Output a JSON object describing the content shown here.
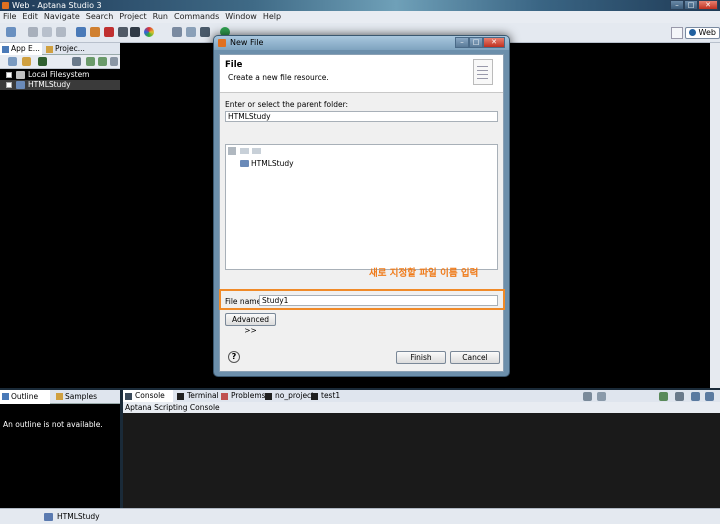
{
  "window": {
    "title": "Web - Aptana Studio 3"
  },
  "menu": [
    "File",
    "Edit",
    "Navigate",
    "Search",
    "Project",
    "Run",
    "Commands",
    "Window",
    "Help"
  ],
  "perspective": {
    "label": "Web"
  },
  "left_panel": {
    "tabs": [
      "App E...",
      "Projec..."
    ],
    "tree": [
      {
        "label": "Local Filesystem"
      },
      {
        "label": "HTMLStudy"
      }
    ]
  },
  "outline": {
    "tabs": [
      "Outline",
      "Samples"
    ],
    "message": "An outline is not available."
  },
  "console": {
    "tabs": [
      "Console",
      "Terminal",
      "Problems",
      "no_project",
      "test1"
    ],
    "header": "Aptana Scripting Console"
  },
  "statusbar": {
    "text": "HTMLStudy"
  },
  "dialog": {
    "title": "New File",
    "heading": "File",
    "description": "Create a new file resource.",
    "parent_label": "Enter or select the parent folder:",
    "parent_value": "HTMLStudy",
    "tree_node": "HTMLStudy",
    "annotation": "새로 지정할 파일 이름 입력",
    "file_name_label": "File name:",
    "file_name_value": "Study1",
    "advanced_label": "Advanced >>",
    "finish_label": "Finish",
    "cancel_label": "Cancel",
    "help_symbol": "?"
  },
  "colors": {
    "accent_orange": "#f08a28",
    "annotation_text": "#f07a18"
  }
}
